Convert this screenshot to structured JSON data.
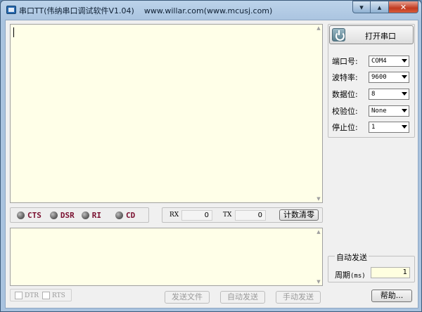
{
  "window": {
    "title": "串口TT(伟纳串口调试软件V1.04)",
    "url": "www.willar.com(www.mcusj.com)",
    "min_glyph": "▾",
    "max_glyph": "▴",
    "close_glyph": "✕"
  },
  "status_lights": [
    {
      "label": "CTS"
    },
    {
      "label": "DSR"
    },
    {
      "label": "RI"
    },
    {
      "label": "CD"
    }
  ],
  "counters": {
    "rx_label": "RX",
    "rx_value": "0",
    "tx_label": "TX",
    "tx_value": "0",
    "clear_label": "计数清零"
  },
  "serial": {
    "open_label": "打开串口",
    "fields": [
      {
        "label": "端口号:",
        "value": "COM4"
      },
      {
        "label": "波特率:",
        "value": "9600"
      },
      {
        "label": "数据位:",
        "value": "8"
      },
      {
        "label": "校验位:",
        "value": "None"
      },
      {
        "label": "停止位:",
        "value": "1"
      }
    ]
  },
  "auto_send": {
    "title": "自动发送",
    "period_label": "周期",
    "period_unit": "(ms)",
    "period_value": "1"
  },
  "bottom": {
    "dtr_label": "DTR",
    "rts_label": "RTS",
    "send_file_label": "发送文件",
    "auto_send_label": "自动发送",
    "manual_send_label": "手动发送",
    "help_label": "帮助..."
  },
  "scroll": {
    "up": "▲",
    "down": "▼"
  },
  "colors": {
    "text_area_bg": "#ffffe8",
    "led_label": "#7a1030"
  }
}
